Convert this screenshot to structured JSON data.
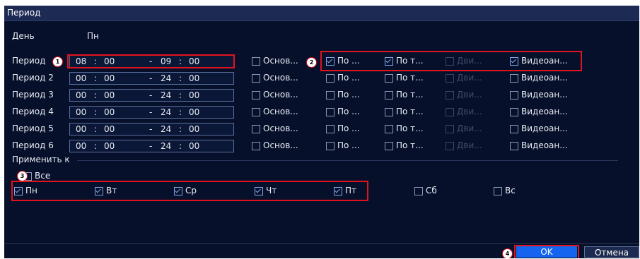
{
  "title": "Период",
  "day": {
    "label": "День",
    "value": "Пн"
  },
  "periods": [
    {
      "label": "Период",
      "start_h": "08",
      "start_m": "00",
      "end_h": "09",
      "end_m": "00",
      "checks": [
        {
          "label": "Основ...",
          "checked": false
        },
        {
          "label": "По ...",
          "checked": true
        },
        {
          "label": "По т...",
          "checked": true
        },
        {
          "label": "Дви...",
          "checked": false,
          "disabled": true
        },
        {
          "label": "Видеоан...",
          "checked": true
        }
      ]
    },
    {
      "label": "Период 2",
      "start_h": "00",
      "start_m": "00",
      "end_h": "24",
      "end_m": "00",
      "checks": [
        {
          "label": "Основ...",
          "checked": false
        },
        {
          "label": "По ...",
          "checked": false
        },
        {
          "label": "По т...",
          "checked": false
        },
        {
          "label": "Дви...",
          "checked": false,
          "disabled": true
        },
        {
          "label": "Видеоан...",
          "checked": false
        }
      ]
    },
    {
      "label": "Период 3",
      "start_h": "00",
      "start_m": "00",
      "end_h": "24",
      "end_m": "00",
      "checks": [
        {
          "label": "Основ...",
          "checked": false
        },
        {
          "label": "По ...",
          "checked": false
        },
        {
          "label": "По т...",
          "checked": false
        },
        {
          "label": "Дви...",
          "checked": false,
          "disabled": true
        },
        {
          "label": "Видеоан...",
          "checked": false
        }
      ]
    },
    {
      "label": "Период 4",
      "start_h": "00",
      "start_m": "00",
      "end_h": "24",
      "end_m": "00",
      "checks": [
        {
          "label": "Основ...",
          "checked": false
        },
        {
          "label": "По ...",
          "checked": false
        },
        {
          "label": "По т...",
          "checked": false
        },
        {
          "label": "Дви...",
          "checked": false,
          "disabled": true
        },
        {
          "label": "Видеоан...",
          "checked": false
        }
      ]
    },
    {
      "label": "Период 5",
      "start_h": "00",
      "start_m": "00",
      "end_h": "24",
      "end_m": "00",
      "checks": [
        {
          "label": "Основ...",
          "checked": false
        },
        {
          "label": "По ...",
          "checked": false
        },
        {
          "label": "По т...",
          "checked": false
        },
        {
          "label": "Дви...",
          "checked": false,
          "disabled": true
        },
        {
          "label": "Видеоан...",
          "checked": false
        }
      ]
    },
    {
      "label": "Период 6",
      "start_h": "00",
      "start_m": "00",
      "end_h": "24",
      "end_m": "00",
      "checks": [
        {
          "label": "Основ...",
          "checked": false
        },
        {
          "label": "По ...",
          "checked": false
        },
        {
          "label": "По т...",
          "checked": false
        },
        {
          "label": "Дви...",
          "checked": false,
          "disabled": true
        },
        {
          "label": "Видеоан...",
          "checked": false
        }
      ]
    }
  ],
  "apply": {
    "label": "Применить к",
    "all": {
      "label": "Все",
      "checked": false
    },
    "days": [
      {
        "label": "Пн",
        "checked": true
      },
      {
        "label": "Вт",
        "checked": true
      },
      {
        "label": "Ср",
        "checked": true
      },
      {
        "label": "Чт",
        "checked": true
      },
      {
        "label": "Пт",
        "checked": true
      },
      {
        "label": "Сб",
        "checked": false
      },
      {
        "label": "Вс",
        "checked": false
      }
    ]
  },
  "buttons": {
    "ok": "OK",
    "cancel": "Отмена"
  },
  "annotations": [
    "1",
    "2",
    "3",
    "4"
  ],
  "colors": {
    "background": "#07102a",
    "accent": "#1464f0",
    "highlight": "#e0141e",
    "check": "#7fa6e8"
  }
}
